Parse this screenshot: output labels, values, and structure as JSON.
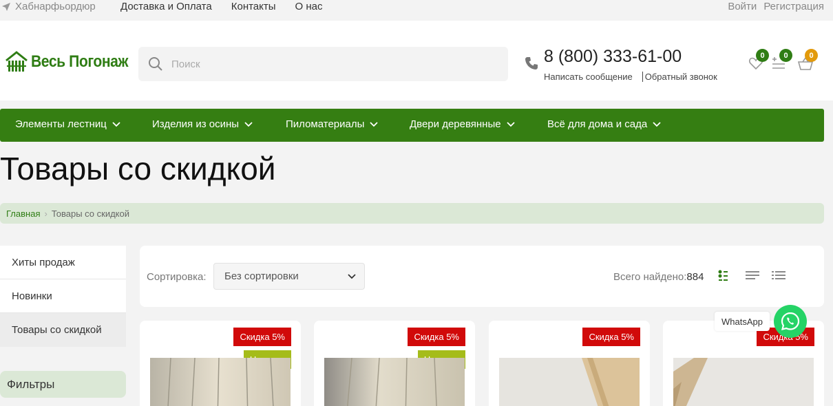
{
  "topbar": {
    "city": "Хабнарфьордюр",
    "links": [
      "Доставка и Оплата",
      "Контакты",
      "О нас"
    ],
    "login": "Войти",
    "register": "Регистрация"
  },
  "header": {
    "logo_text": "Весь Погонаж",
    "search_placeholder": "Поиск",
    "phone": "8 (800) 333-61-00",
    "write_message": "Написать сообщение",
    "callback": "Обратный звонок",
    "favorites_count": "0",
    "compare_count": "0",
    "cart_count": "0"
  },
  "menu": {
    "items": [
      "Элементы лестниц",
      "Изделия из осины",
      "Пиломатериалы",
      "Двери деревянные",
      "Всё для дома и сада"
    ]
  },
  "page": {
    "title": "Товары со скидкой"
  },
  "breadcrumb": {
    "home": "Главная",
    "current": "Товары со скидкой"
  },
  "sidebar": {
    "items": [
      "Хиты продаж",
      "Новинки",
      "Товары со скидкой"
    ],
    "filters": "Фильтры"
  },
  "sort": {
    "label": "Сортировка:",
    "value": "Без сортировки",
    "total_label": "Всего найдено:",
    "total_value": "884"
  },
  "products": [
    {
      "sale": "Скидка 5%",
      "new": "Новинка"
    },
    {
      "sale": "Скидка 5%",
      "new": "Новинка"
    },
    {
      "sale": "Скидка 5%"
    },
    {
      "sale": "Скидка 5%"
    }
  ],
  "whatsapp": {
    "label": "WhatsApp"
  },
  "colors": {
    "brand_green": "#357e12",
    "sale_red": "#d10a0a",
    "new_olive": "#a5bc1a",
    "cart_badge": "#e29a0c",
    "whatsapp": "#25d366"
  }
}
